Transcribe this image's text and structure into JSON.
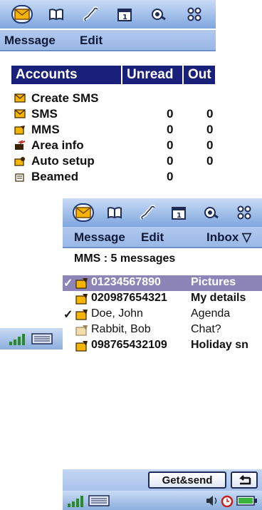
{
  "back_screen": {
    "menu": {
      "message": "Message",
      "edit": "Edit"
    },
    "table_header": {
      "accounts": "Accounts",
      "unread": "Unread",
      "out": "Out"
    },
    "rows": [
      {
        "label": "Create SMS",
        "unread": "",
        "out": "",
        "icon": "envelope-icon"
      },
      {
        "label": "SMS",
        "unread": "0",
        "out": "0",
        "icon": "envelope-icon"
      },
      {
        "label": "MMS",
        "unread": "0",
        "out": "0",
        "icon": "mms-icon"
      },
      {
        "label": "Area info",
        "unread": "0",
        "out": "0",
        "icon": "area-info-icon"
      },
      {
        "label": "Auto setup",
        "unread": "0",
        "out": "0",
        "icon": "auto-setup-icon"
      },
      {
        "label": "Beamed",
        "unread": "0",
        "out": "",
        "icon": "beamed-icon"
      }
    ]
  },
  "front_screen": {
    "menu": {
      "message": "Message",
      "edit": "Edit",
      "folder": "Inbox ▽"
    },
    "count_text": "MMS : 5 messages",
    "messages": [
      {
        "from": "01234567890",
        "subject": "Pictures",
        "checked": true,
        "selected": true,
        "unread": true
      },
      {
        "from": "020987654321",
        "subject": "My details",
        "checked": false,
        "selected": false,
        "unread": true
      },
      {
        "from": "Doe, John",
        "subject": "Agenda",
        "checked": true,
        "selected": false,
        "unread": false
      },
      {
        "from": "Rabbit, Bob",
        "subject": "Chat?",
        "checked": false,
        "selected": false,
        "unread": false
      },
      {
        "from": "098765432109",
        "subject": "Holiday sn",
        "checked": false,
        "selected": false,
        "unread": true
      }
    ],
    "buttons": {
      "get_send": "Get&send",
      "back_glyph": "⮌"
    }
  },
  "toolbar_icons": [
    "messaging-icon",
    "contacts-icon",
    "phone-icon",
    "calendar-icon",
    "web-icon",
    "apps-icon"
  ],
  "colors": {
    "accent": "#18207a",
    "selection": "#8d85b8",
    "bar": "#9ab7e6"
  }
}
